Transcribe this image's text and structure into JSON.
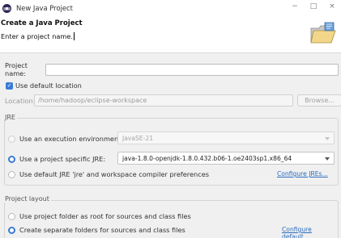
{
  "window": {
    "title": "New Java Project",
    "controls": {
      "minimize": "−",
      "maximize": "□",
      "close": "×"
    }
  },
  "banner": {
    "title": "Create a Java Project",
    "message": "Enter a project name."
  },
  "project_name": {
    "label": "Project name:",
    "value": ""
  },
  "default_location": {
    "checkbox_label": "Use default location",
    "checked": true,
    "location_label": "Location:",
    "location_value": "/home/hadoop/eclipse-workspace",
    "browse_label": "Browse..."
  },
  "jre": {
    "group_label": "JRE",
    "options": [
      {
        "label": "Use an execution environment JRE:",
        "selected": false,
        "value": "JavaSE-21"
      },
      {
        "label": "Use a project specific JRE:",
        "selected": true,
        "value": "java-1.8.0-openjdk-1.8.0.432.b06-1.oe2403sp1.x86_64"
      },
      {
        "label": "Use default JRE 'jre' and workspace compiler preferences",
        "selected": false
      }
    ],
    "configure_link": "Configure JREs..."
  },
  "project_layout": {
    "group_label": "Project layout",
    "options": [
      {
        "label": "Use project folder as root for sources and class files",
        "selected": false
      },
      {
        "label": "Create separate folders for sources and class files",
        "selected": true
      }
    ],
    "configure_link": "Configure default..."
  },
  "colors": {
    "accent": "#3a7bd5",
    "link": "#2a6bbf"
  },
  "icons": {
    "app": "eclipse-icon",
    "wizard": "folder-icon"
  }
}
